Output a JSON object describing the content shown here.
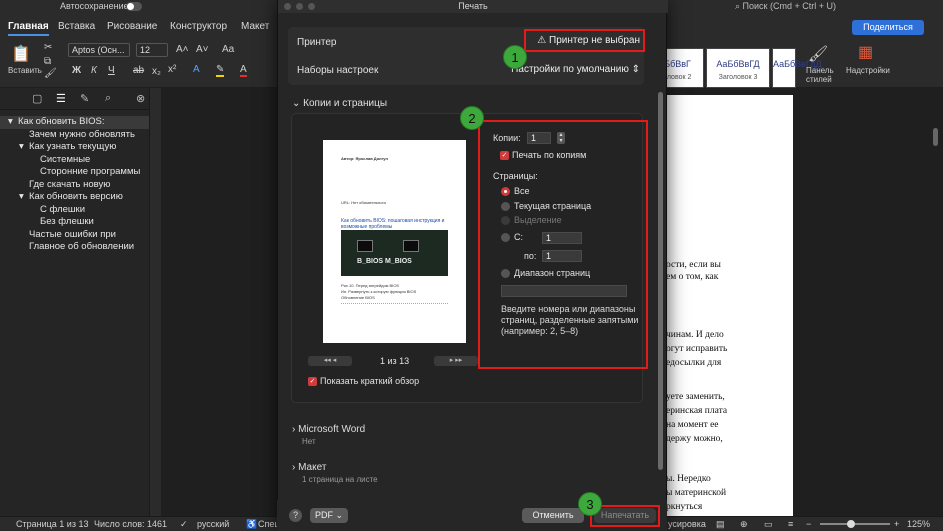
{
  "titlebar": {
    "autosave_label": "Автосохранение",
    "search_placeholder": "Поиск (Cmd + Ctrl + U)"
  },
  "ribbon": {
    "tabs": [
      "Главная",
      "Вставка",
      "Рисование",
      "Конструктор",
      "Макет"
    ],
    "share_label": "Поделиться",
    "paste_label": "Вставить",
    "font_name": "Aptos (Осн...",
    "font_size": "12",
    "styles": [
      {
        "sample": "АаБбВвГ",
        "name": "Заголовок 2"
      },
      {
        "sample": "АаБбВвГД",
        "name": "Заголовок 3"
      },
      {
        "sample": "АаБбВвГдД",
        "name": "Заголовок 4"
      }
    ],
    "styles_pane_label": "Панель стилей",
    "addins_label": "Надстройки"
  },
  "navigation": {
    "items": [
      {
        "label": "Как обновить BIOS:",
        "level": 0,
        "arrow": "▾",
        "selected": true
      },
      {
        "label": "Зачем нужно обновлять",
        "level": 1,
        "arrow": ""
      },
      {
        "label": "Как узнать текущую",
        "level": 1,
        "arrow": "▾"
      },
      {
        "label": "Системные",
        "level": 2,
        "arrow": ""
      },
      {
        "label": "Сторонние программы",
        "level": 2,
        "arrow": ""
      },
      {
        "label": "Где скачать новую",
        "level": 1,
        "arrow": ""
      },
      {
        "label": "Как обновить версию",
        "level": 1,
        "arrow": "▾"
      },
      {
        "label": "С флешки",
        "level": 2,
        "arrow": ""
      },
      {
        "label": "Без флешки",
        "level": 2,
        "arrow": ""
      },
      {
        "label": "Частые ошибки при",
        "level": 1,
        "arrow": ""
      },
      {
        "label": "Главное об обновлении",
        "level": 1,
        "arrow": ""
      }
    ]
  },
  "document": {
    "lines": [
      "ости,  если  вы",
      "ем о том, как",
      "чинам. И дело",
      "огут исправить",
      "едосылки для",
      "уете заменить,",
      "еринская плата",
      "на  момент  ее",
      "держу можно,",
      "ы.   Нередко",
      "ы материнской",
      "ркнуться"
    ]
  },
  "statusbar": {
    "page": "Страница 1 из 13",
    "words": "Число слов: 1461",
    "language": "русский",
    "special": "Спец",
    "focus_tail": "усировка",
    "zoom": "125%"
  },
  "dialog": {
    "title": "Печать",
    "printer_label": "Принтер",
    "printer_value": "Принтер не выбран",
    "presets_label": "Наборы настроек",
    "presets_value": "Настройки по умолчанию",
    "copies_section": "Копии и страницы",
    "copies_label": "Копии:",
    "copies_value": "1",
    "collate_label": "Печать по копиям",
    "pages_label": "Страницы:",
    "page_options": [
      "Все",
      "Текущая страница",
      "Выделение",
      "С:",
      "Диапазон страниц"
    ],
    "from_value": "1",
    "to_label": "по:",
    "to_value": "1",
    "range_hint": "Введите номера или диапазоны страниц, разделенные запятыми (например: 2, 5–8)",
    "page_counter": "1 из 13",
    "show_quick_preview": "Показать краткий обзор",
    "preview": {
      "author": "Автор: Ярослав Долгун",
      "url_line": "URL: Нет обязательного",
      "article_title": "Как обновить BIOS: пошаговая инструкция и возможные проблемы",
      "foot_lines": [
        "Рис.10. Перед апгрейдом BIOS",
        "Ин. Развернуть к которую функция BIOS",
        "Обновление BIOS"
      ],
      "image_text": "B_BIOS  M_BIOS"
    },
    "word_section": "Microsoft Word",
    "word_sub": "Нет",
    "layout_section": "Макет",
    "layout_sub": "1 страница на листе",
    "help": "?",
    "pdf_label": "PDF",
    "cancel_label": "Отменить",
    "print_label": "Напечатать"
  },
  "annotations": [
    "1",
    "2",
    "3"
  ],
  "colors": {
    "highlight": "#e21b1b",
    "badge": "#3da93d",
    "accent": "#2e6fd8"
  }
}
